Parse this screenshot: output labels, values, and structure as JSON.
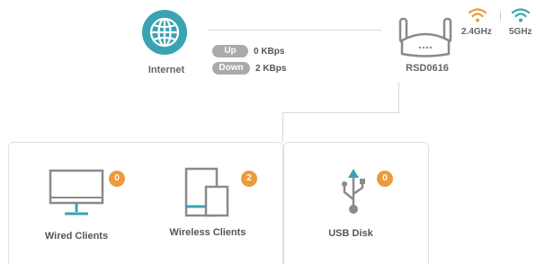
{
  "internet": {
    "label": "Internet"
  },
  "speeds": {
    "up_label": "Up",
    "up_value": "0 KBps",
    "down_label": "Down",
    "down_value": "2 KBps"
  },
  "router": {
    "name": "RSD0616",
    "band_24": "2.4GHz",
    "band_5": "5GHz"
  },
  "cards": {
    "wired": {
      "label": "Wired Clients",
      "count": "0"
    },
    "wireless": {
      "label": "Wireless Clients",
      "count": "2"
    },
    "usb": {
      "label": "USB Disk",
      "count": "0"
    }
  },
  "colors": {
    "teal": "#3aa3b1",
    "orange": "#ec9a3c",
    "gray_icon": "#8a8a8a",
    "pill": "#aaaaaa"
  }
}
